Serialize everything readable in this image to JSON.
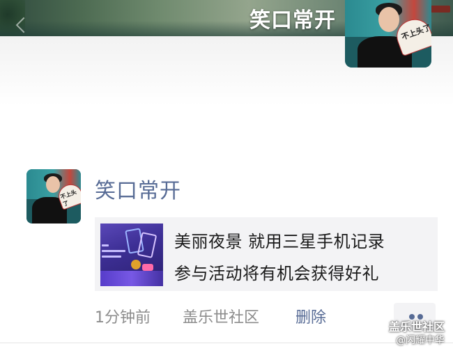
{
  "cover": {
    "name": "笑口常开"
  },
  "post": {
    "username": "笑口常开",
    "card": {
      "line1": "美丽夜景 就用三星手机记录",
      "line2": "参与活动将有机会获得好礼"
    },
    "time": "1分钟前",
    "source": "盖乐世社区",
    "delete_label": "删除"
  },
  "avatar_fan_text": "不上头了",
  "watermark": {
    "line1": "盖乐世社区",
    "line2": "@闪耀中华"
  },
  "colors": {
    "link": "#576b95",
    "meta": "#8c8c8c",
    "card_bg": "#f3f3f5"
  }
}
